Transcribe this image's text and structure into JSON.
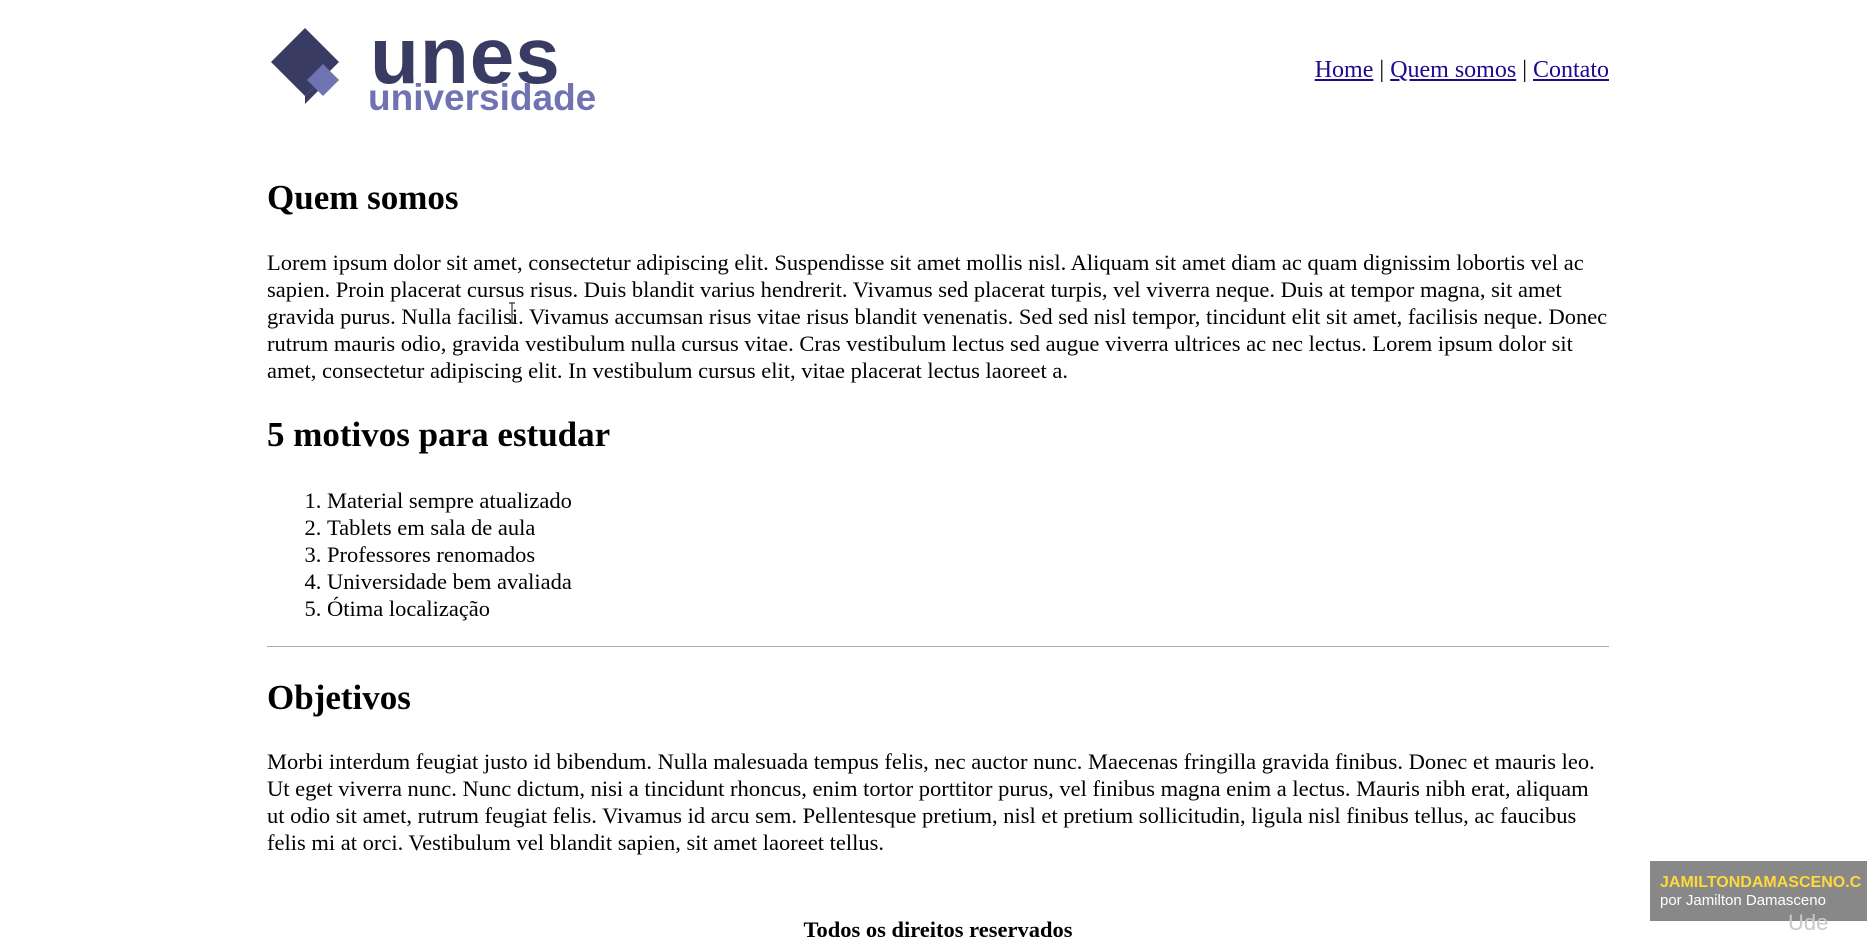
{
  "logo": {
    "main_text": "unes",
    "sub_text": "universidade",
    "colors": {
      "dark": "#393b63",
      "light": "#6f73b1"
    }
  },
  "nav": {
    "items": [
      {
        "label": "Home"
      },
      {
        "label": "Quem somos"
      },
      {
        "label": "Contato"
      }
    ],
    "separator": "|",
    "link_color": "#1f0a8f"
  },
  "sections": {
    "quem_somos": {
      "heading": "Quem somos",
      "text": "Lorem ipsum dolor sit amet, consectetur adipiscing elit. Suspendisse sit amet mollis nisl. Aliquam sit amet diam ac quam dignissim lobortis vel ac sapien. Proin placerat cursus risus. Duis blandit varius hendrerit. Vivamus sed placerat turpis, vel viverra neque. Duis at tempor magna, sit amet gravida purus. Nulla facilisi. Vivamus accumsan risus vitae risus blandit venenatis. Sed sed nisl tempor, tincidunt elit sit amet, facilisis neque. Donec rutrum mauris odio, gravida vestibulum nulla cursus vitae. Cras vestibulum lectus sed augue viverra ultrices ac nec lectus. Lorem ipsum dolor sit amet, consectetur adipiscing elit. In vestibulum cursus elit, vitae placerat lectus laoreet a."
    },
    "motivos": {
      "heading": "5 motivos para estudar",
      "items": [
        "Material sempre atualizado",
        "Tablets em sala de aula",
        "Professores renomados",
        "Universidade bem avaliada",
        "Ótima localização"
      ]
    },
    "objetivos": {
      "heading": "Objetivos",
      "text": "Morbi interdum feugiat justo id bibendum. Nulla malesuada tempus felis, nec auctor nunc. Maecenas fringilla gravida finibus. Donec et mauris leo. Ut eget viverra nunc. Nunc dictum, nisi a tincidunt rhoncus, enim tortor porttitor purus, vel finibus magna enim a lectus. Mauris nibh erat, aliquam ut odio sit amet, rutrum feugiat felis. Vivamus id arcu sem. Pellentesque pretium, nisl et pretium sollicitudin, ligula nisl finibus tellus, ac faucibus felis mi at orci. Vestibulum vel blandit sapien, sit amet laoreet tellus."
    }
  },
  "footer": {
    "text": "Todos os direitos reservados"
  },
  "watermark": {
    "site": "JAMILTONDAMASCENO.C",
    "author": "por Jamilton Damasceno",
    "brand": "Ude",
    "colors": {
      "site": "#ffd93a",
      "author": "#ffffff"
    }
  },
  "cursor_icon": "text-cursor-icon"
}
